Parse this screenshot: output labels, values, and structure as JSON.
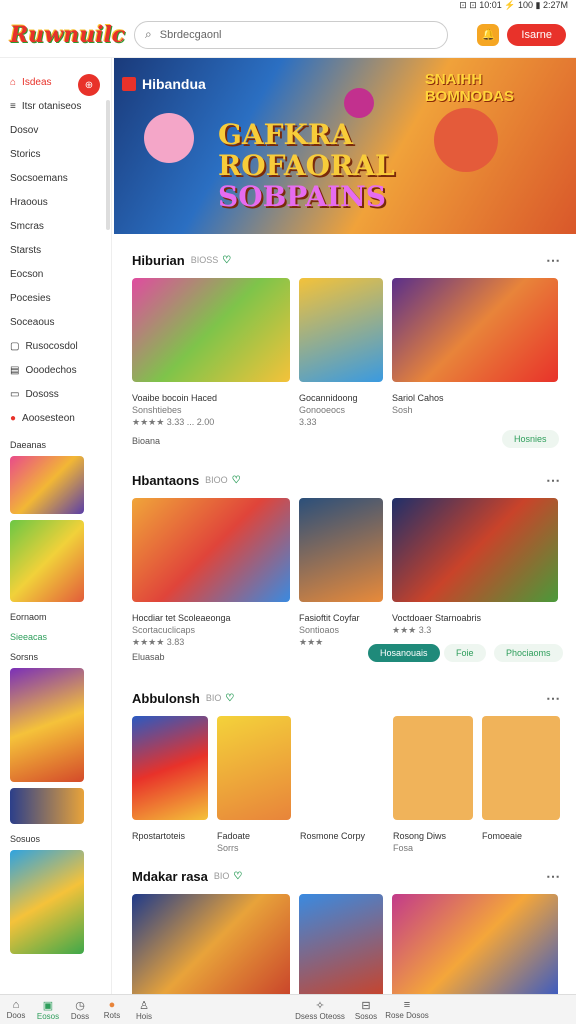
{
  "status": {
    "text": "⊡ ⊡ 10:01 ⚡ 100 ▮ 2:27M"
  },
  "header": {
    "logo": "Ruwnuilc",
    "search_placeholder": "Sbrdecgaonl",
    "signin": "Isarne"
  },
  "sidebar": {
    "items": [
      {
        "label": "Isdeas",
        "active": true
      },
      {
        "label": "Itsr otaniseos"
      },
      {
        "label": "Dosov"
      },
      {
        "label": "Storics"
      },
      {
        "label": "Socsoemans"
      },
      {
        "label": "Hraoous"
      },
      {
        "label": "Smcras"
      },
      {
        "label": "Starsts"
      },
      {
        "label": "Eocson"
      },
      {
        "label": "Pocesies"
      },
      {
        "label": "Soceaous"
      },
      {
        "label": "Rusocosdol"
      },
      {
        "label": "Ooodechos"
      },
      {
        "label": "Dososs"
      },
      {
        "label": "Aoosesteon"
      }
    ],
    "sec1": "Daeanas",
    "sec2": "Eornaom",
    "sec2b": "Sieeacas",
    "sec3": "Sorsns",
    "sec4": "Sosuos"
  },
  "hero": {
    "title": "Hibandua",
    "big1": "GAFKRA",
    "big2": "ROFAORAL",
    "big3": "SOBPAINS",
    "tag1": "SNAIHH",
    "tag2": "BOMNODAS"
  },
  "sections": [
    {
      "title": "Hiburian",
      "sub": "BIOSS",
      "cards": [
        {
          "name": "Voaibe bocoin Haced",
          "sub": "Sonshtiebes",
          "rating": "★★★★ 3.33 ... 2.00"
        },
        {
          "name": "Gocannidoong",
          "sub": "Gonooeocs",
          "rating": "3.33"
        },
        {
          "name": "Sariol Cahos",
          "sub": "Sosh"
        }
      ],
      "action": "Hosnies",
      "footer": "Bioana"
    },
    {
      "title": "Hbantaons",
      "sub": "BIOO",
      "cards": [
        {
          "name": "Hocdiar tet Scoleaeonga",
          "sub": "Scortacuclicaps",
          "rating": "★★★★ 3.83"
        },
        {
          "name": "Fasioftit Coyfar",
          "sub": "Sontioaos",
          "rating": "★★★"
        },
        {
          "name": "Voctdoaer Starnoabris",
          "sub": "",
          "rating": "★★★ 3.3"
        }
      ],
      "actions": [
        "Hosanouais",
        "Foie",
        "Phociaoms"
      ],
      "footer": "Eluasab"
    },
    {
      "title": "Abbulonsh",
      "sub": "BIO",
      "cards": [
        {
          "name": "Rpostartoteis",
          "sub": ""
        },
        {
          "name": "Fadoate",
          "sub": "Sorrs"
        },
        {
          "name": "Rosmone Corpy",
          "sub": ""
        },
        {
          "name": "Rosong Diws",
          "sub": "Fosa"
        },
        {
          "name": "Fomoeaie",
          "sub": ""
        }
      ]
    },
    {
      "title": "Mdakar rasa",
      "sub": "BIO"
    }
  ],
  "bottom": [
    {
      "label": "Doos",
      "icon": "home-icon"
    },
    {
      "label": "Eosos",
      "icon": "games-icon"
    },
    {
      "label": "Doss",
      "icon": "clock-icon"
    },
    {
      "label": "Rots",
      "icon": "gift-icon"
    },
    {
      "label": "Hois",
      "icon": "user-icon"
    },
    {
      "label": "Dsess Oteoss",
      "icon": "sparkle-icon"
    },
    {
      "label": "Sosos",
      "icon": "store-icon"
    },
    {
      "label": "Rose Dosos",
      "icon": "menu-icon"
    }
  ]
}
